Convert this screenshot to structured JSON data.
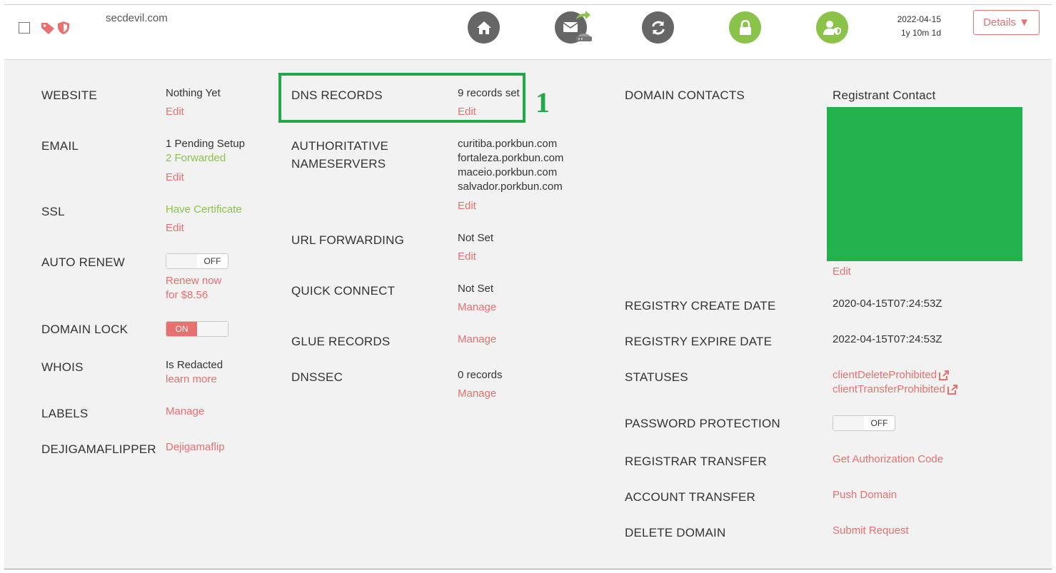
{
  "header": {
    "domain": "secdevil.com",
    "date": "2022-04-15",
    "age": "1y 10m 1d",
    "details_label": "Details ▼",
    "icons": [
      "tag-icon",
      "shield-icon",
      "home-icon",
      "email-forward-icon",
      "refresh-icon",
      "lock-icon",
      "user-shield-icon"
    ]
  },
  "colors": {
    "accent": "#e8716f",
    "green": "#8bc34a",
    "highlight": "#22a84a",
    "redacted": "#22b14c"
  },
  "left": {
    "website": {
      "label": "WEBSITE",
      "value": "Nothing Yet",
      "edit": "Edit"
    },
    "email": {
      "label": "EMAIL",
      "value": "1 Pending Setup",
      "forwarded": "2 Forwarded",
      "edit": "Edit"
    },
    "ssl": {
      "label": "SSL",
      "value": "Have Certificate",
      "edit": "Edit"
    },
    "auto_renew": {
      "label": "AUTO RENEW",
      "toggle": "OFF",
      "renew1": "Renew now",
      "renew2": "for $8.56"
    },
    "domain_lock": {
      "label": "DOMAIN LOCK",
      "toggle": "ON"
    },
    "whois": {
      "label": "WHOIS",
      "value": "Is Redacted",
      "link": "learn more"
    },
    "labels": {
      "label": "LABELS",
      "link": "Manage"
    },
    "flipper": {
      "label": "DEJIGAMAFLIPPER",
      "link": "Dejigamaflip"
    }
  },
  "middle": {
    "dns": {
      "label": "DNS RECORDS",
      "value": "9 records set",
      "edit": "Edit"
    },
    "ns": {
      "label1": "AUTHORITATIVE",
      "label2": "NAMESERVERS",
      "servers": [
        "curitiba.porkbun.com",
        "fortaleza.porkbun.com",
        "maceio.porkbun.com",
        "salvador.porkbun.com"
      ],
      "edit": "Edit"
    },
    "url_fwd": {
      "label": "URL FORWARDING",
      "value": "Not Set",
      "edit": "Edit"
    },
    "quick": {
      "label": "QUICK CONNECT",
      "value": "Not Set",
      "link": "Manage"
    },
    "glue": {
      "label": "GLUE RECORDS",
      "link": "Manage"
    },
    "dnssec": {
      "label": "DNSSEC",
      "value": "0 records",
      "link": "Manage"
    }
  },
  "annotation": {
    "number": "1"
  },
  "right": {
    "contacts": {
      "label": "DOMAIN CONTACTS",
      "title": "Registrant Contact",
      "edit": "Edit"
    },
    "create": {
      "label": "REGISTRY CREATE DATE",
      "value": "2020-04-15T07:24:53Z"
    },
    "expire": {
      "label": "REGISTRY EXPIRE DATE",
      "value": "2022-04-15T07:24:53Z"
    },
    "statuses": {
      "label": "STATUSES",
      "items": [
        "clientDeleteProhibited",
        "clientTransferProhibited"
      ]
    },
    "password": {
      "label": "PASSWORD PROTECTION",
      "toggle": "OFF"
    },
    "registrar": {
      "label": "REGISTRAR TRANSFER",
      "link": "Get Authorization Code"
    },
    "account": {
      "label": "ACCOUNT TRANSFER",
      "link": "Push Domain"
    },
    "delete": {
      "label": "DELETE DOMAIN",
      "link": "Submit Request"
    }
  }
}
